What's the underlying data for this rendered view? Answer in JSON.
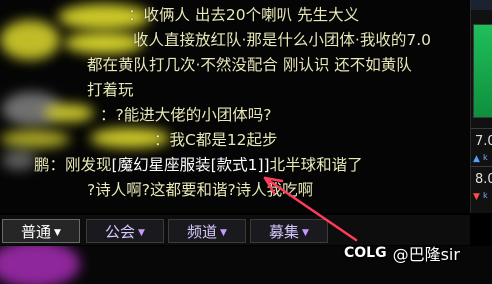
{
  "chat": {
    "lines": [
      {
        "text": "：收俩人 出去20个喇叭 先生大义"
      },
      {
        "text": "收人直接放红队·那是什么小团体·我收的7.0"
      },
      {
        "text": "都在黄队打几次·不然没配合 刚认识 还不如黄队"
      },
      {
        "text": "打着玩"
      },
      {
        "text": "：?能进大佬的小团体吗?"
      },
      {
        "text": "：我C都是12起步"
      },
      {
        "text_prefix": "鹏：刚发现",
        "item_name": "[魔幻星座服装[款式1]]",
        "text_suffix": "北半球和谐了"
      },
      {
        "text": "?诗人啊?这都要和谐?诗人我吃啊"
      }
    ]
  },
  "right_panel": {
    "value_1": "7.0",
    "value_1_sub": "k",
    "value_2": "8.0",
    "value_2_sub": "k"
  },
  "tabs": [
    {
      "label": "普通",
      "active": true
    },
    {
      "label": "公会",
      "active": false
    },
    {
      "label": "频道",
      "active": false
    },
    {
      "label": "募集",
      "active": false
    }
  ],
  "colors": {
    "chat_text": "#e8e8b8",
    "item_link": "#ffffff",
    "tab_text": "#d9c7ff",
    "tab_caret": "#c39bff",
    "panel_green": "#1fbf5a",
    "annotation_arrow": "#ff3b5c"
  },
  "watermark": {
    "logo": "COLG",
    "handle": "@巴隆sir"
  }
}
